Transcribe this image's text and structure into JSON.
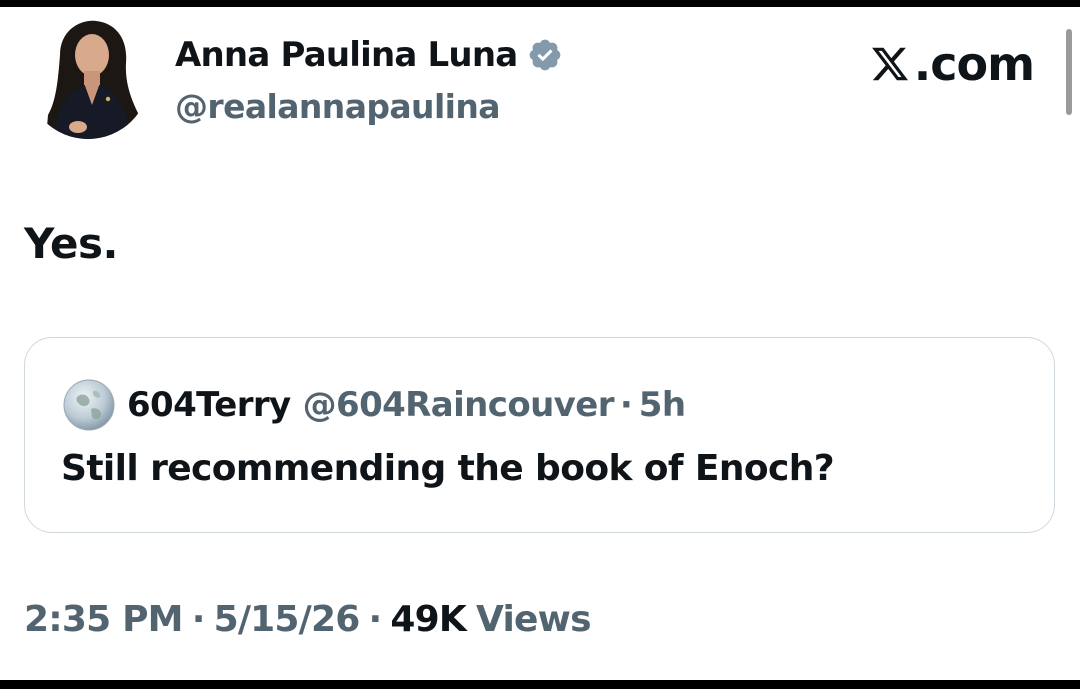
{
  "tweet": {
    "author": {
      "name": "Anna Paulina Luna",
      "handle": "@realannapaulina",
      "verified_icon": "verified-badge-icon",
      "badge_color": "#829aab"
    },
    "brand": {
      "label": ".com",
      "icon": "x-logo-icon"
    },
    "text": "Yes.",
    "quoted_tweet": {
      "author_name": "604Terry",
      "author_handle": "@604Raincouver",
      "separator": "·",
      "time_ago": "5h",
      "text": "Still recommending the book of Enoch?"
    },
    "meta": {
      "time": "2:35 PM",
      "separator": "·",
      "date": "5/15/26",
      "views_count": "49K",
      "views_label": "Views"
    }
  },
  "colors": {
    "text_primary": "#0f1419",
    "text_secondary": "#536471",
    "border": "#cfd9de",
    "background": "#ffffff"
  }
}
